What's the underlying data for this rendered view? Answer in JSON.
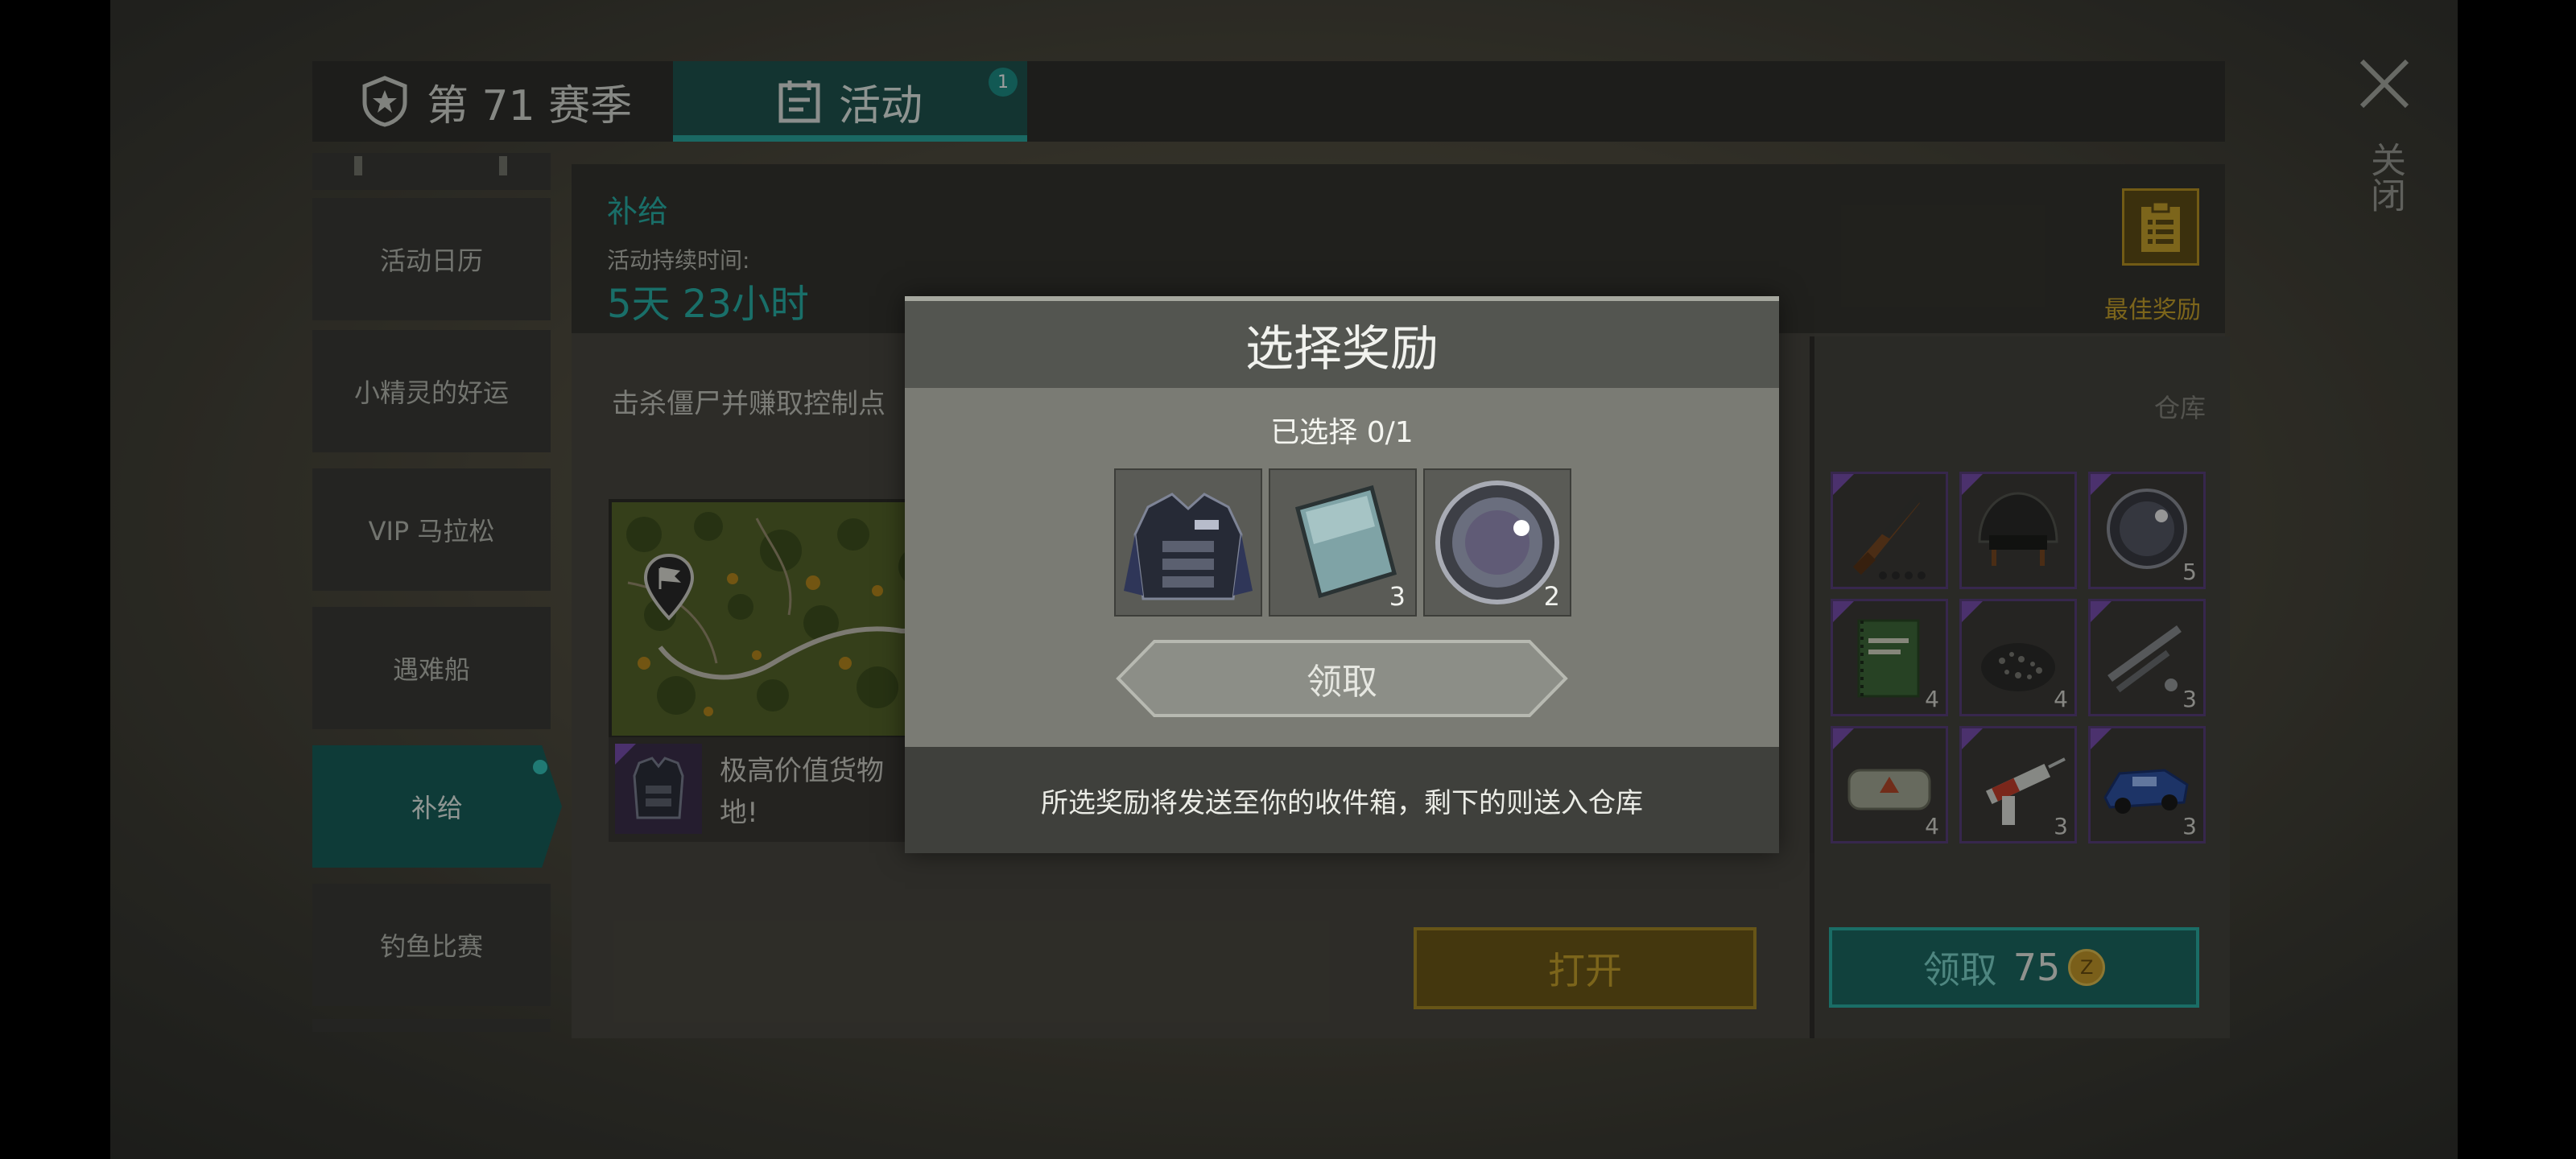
{
  "tabs": {
    "season_label": "第 71 赛季",
    "event_label": "活动",
    "event_badge": "1"
  },
  "close_label": "关闭",
  "sidebar": {
    "items": [
      {
        "label": "活动日历"
      },
      {
        "label": "小精灵的好运"
      },
      {
        "label": "VIP 马拉松"
      },
      {
        "label": "遇难船"
      },
      {
        "label": "补给"
      },
      {
        "label": "钓鱼比赛"
      }
    ],
    "active_index": 4
  },
  "main": {
    "title": "补给",
    "duration_label": "活动持续时间:",
    "duration_value": "5天 23小时",
    "best_reward_label": "最佳奖励",
    "description": "击杀僵尸并赚取控制点",
    "item_text_line1": "极高价值货物",
    "item_text_line2": "地!",
    "open_button": "打开"
  },
  "warehouse": {
    "label": "仓库",
    "items": [
      {
        "icon": "rifle-icon",
        "count": ""
      },
      {
        "icon": "helmet-icon",
        "count": ""
      },
      {
        "icon": "lens-icon",
        "count": "5"
      },
      {
        "icon": "notebook-icon",
        "count": "4"
      },
      {
        "icon": "gravel-icon",
        "count": "4"
      },
      {
        "icon": "pipes-icon",
        "count": "3"
      },
      {
        "icon": "medkit-icon",
        "count": "4"
      },
      {
        "icon": "syringe-icon",
        "count": "3"
      },
      {
        "icon": "vehicle-icon",
        "count": "3"
      }
    ],
    "claim_label": "领取",
    "claim_price": "75",
    "coin_symbol": "Z"
  },
  "dialog": {
    "title": "选择奖励",
    "selected_text": "已选择 0/1",
    "rewards": [
      {
        "icon": "armor-vest-icon",
        "count": ""
      },
      {
        "icon": "metal-plate-icon",
        "count": "3"
      },
      {
        "icon": "lens-icon",
        "count": "2"
      }
    ],
    "claim_button": "领取",
    "footer_note": "所选奖励将发送至你的收件箱，剩下的则送入仓库"
  }
}
